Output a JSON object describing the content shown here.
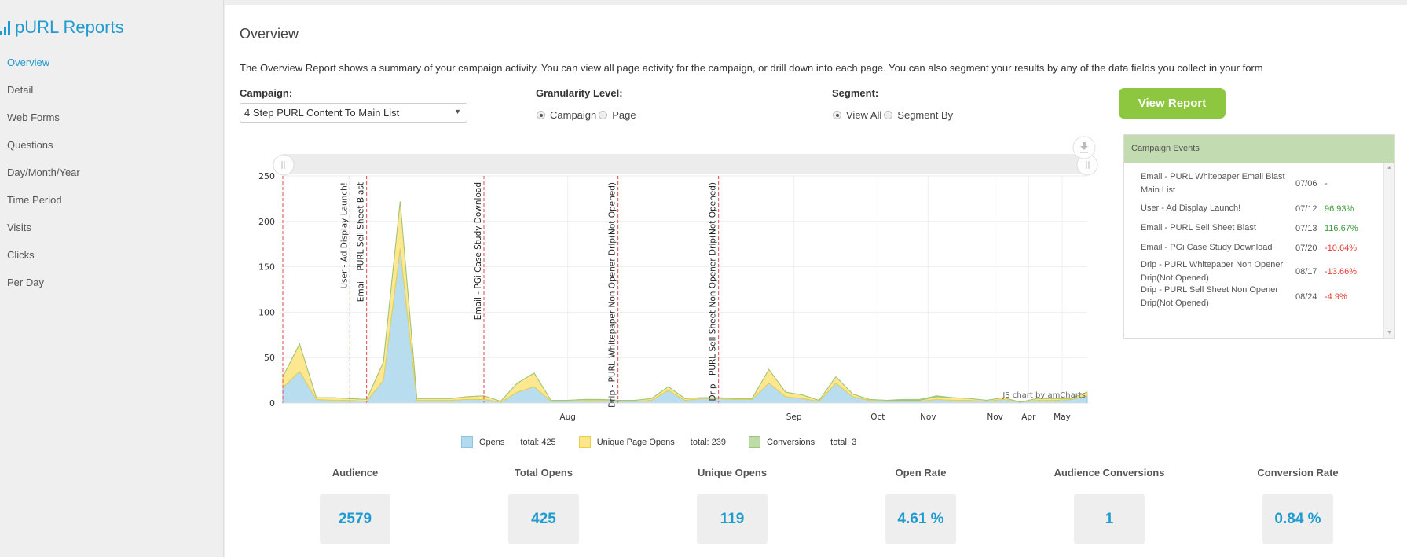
{
  "app": {
    "title": "pURL Reports",
    "brand_icon": "bar-chart-icon"
  },
  "sidebar": {
    "items": [
      {
        "label": "Overview",
        "active": true
      },
      {
        "label": "Detail"
      },
      {
        "label": "Web Forms"
      },
      {
        "label": "Questions"
      },
      {
        "label": "Day/Month/Year"
      },
      {
        "label": "Time Period"
      },
      {
        "label": "Visits"
      },
      {
        "label": "Clicks"
      },
      {
        "label": "Per Day"
      }
    ]
  },
  "main": {
    "title": "Overview",
    "description": "The Overview Report shows a summary of your campaign activity. You can view all page activity for the campaign, or drill down into each page. You can also segment your results by any of the data fields you collect in your form",
    "campaign": {
      "label": "Campaign:",
      "value": "4 Step PURL Content To Main List"
    },
    "granularity": {
      "label": "Granularity Level:",
      "options": [
        "Campaign",
        "Page"
      ],
      "selected": "Campaign"
    },
    "segment": {
      "label": "Segment:",
      "options": [
        "View All",
        "Segment By"
      ],
      "selected": "View All"
    },
    "view_report_label": "View Report"
  },
  "events": {
    "title": "Campaign Events",
    "rows": [
      {
        "name": "Email - PURL Whitepaper Email Blast Main List",
        "date": "07/06",
        "change": "-",
        "trend": "none"
      },
      {
        "name": "User - Ad Display Launch!",
        "date": "07/12",
        "change": "96.93%",
        "trend": "pos"
      },
      {
        "name": "Email - PURL Sell Sheet Blast",
        "date": "07/13",
        "change": "116.67%",
        "trend": "pos"
      },
      {
        "name": "Email - PGi Case Study Download",
        "date": "07/20",
        "change": "-10.64%",
        "trend": "neg"
      },
      {
        "name": "Drip - PURL Whitepaper Non Opener Drip(Not Opened)",
        "date": "08/17",
        "change": "-13.66%",
        "trend": "neg"
      },
      {
        "name": "Drip - PURL Sell Sheet Non Opener Drip(Not Opened)",
        "date": "08/24",
        "change": "-4.9%",
        "trend": "neg"
      }
    ]
  },
  "chart_data": {
    "type": "area",
    "stacked": true,
    "ylim": [
      0,
      250
    ],
    "yticks": [
      0,
      50,
      100,
      150,
      200,
      250
    ],
    "xtick_labels": [
      {
        "label": "Aug",
        "index": 17
      },
      {
        "label": "Sep",
        "index": 30.5
      },
      {
        "label": "Oct",
        "index": 35.5
      },
      {
        "label": "Nov",
        "index": 38.5
      },
      {
        "label": "Nov",
        "index": 42.5
      },
      {
        "label": "Apr",
        "index": 44.5
      },
      {
        "label": "May",
        "index": 46.5
      }
    ],
    "point_count": 48,
    "series": [
      {
        "name": "Opens",
        "total_label": "total: 425",
        "color": "#b3dbee",
        "border": "#8ec5e0",
        "values": [
          17,
          35,
          4,
          3,
          3,
          2,
          25,
          170,
          3,
          3,
          3,
          4,
          4,
          1,
          12,
          18,
          2,
          2,
          3,
          3,
          2,
          2,
          3,
          14,
          3,
          5,
          5,
          4,
          4,
          22,
          7,
          5,
          2,
          22,
          7,
          3,
          2,
          2,
          2,
          4,
          3,
          3,
          2,
          4,
          1,
          3,
          3,
          4,
          8
        ]
      },
      {
        "name": "Unique Page Opens",
        "total_label": "total: 239",
        "color": "#fde68a",
        "border": "#e8cf4c",
        "values": [
          12,
          30,
          2,
          3,
          2,
          2,
          20,
          52,
          2,
          2,
          2,
          3,
          4,
          1,
          10,
          15,
          1,
          1,
          1,
          1,
          1,
          1,
          2,
          4,
          2,
          1,
          1,
          1,
          1,
          15,
          5,
          4,
          1,
          7,
          3,
          1,
          1,
          1,
          1,
          3,
          3,
          2,
          1,
          2,
          0,
          2,
          2,
          1,
          4
        ]
      },
      {
        "name": "Conversions",
        "total_label": "total: 3",
        "color": "#bedaa6",
        "border": "#9cc67c",
        "values": [
          0,
          0,
          0,
          0,
          0,
          0,
          0,
          0,
          0,
          0,
          0,
          0,
          0,
          0,
          0,
          0,
          0,
          0,
          0,
          0,
          0,
          0,
          0,
          0,
          0,
          0,
          0,
          0,
          0,
          0,
          0,
          0,
          0,
          0,
          0,
          0,
          0,
          1,
          1,
          1,
          0,
          0,
          0,
          0,
          0,
          0,
          0,
          0,
          0
        ]
      }
    ],
    "events": [
      {
        "label": "Email - PURL Whitepaper Email Blast Main List",
        "index": 0,
        "show_label": false
      },
      {
        "label": "User - Ad Display Launch!",
        "index": 4
      },
      {
        "label": "Email - PURL Sell Sheet Blast",
        "index": 5
      },
      {
        "label": "Email - PGi Case Study Download",
        "index": 12
      },
      {
        "label": "Drip - PURL Whitepaper Non Opener Drip(Not Opened)",
        "index": 20
      },
      {
        "label": "Drip - PURL Sell Sheet Non Opener Drip(Not Opened)",
        "index": 26
      }
    ],
    "credit": "JS chart by amCharts"
  },
  "metrics": [
    {
      "label": "Audience",
      "value": "2579"
    },
    {
      "label": "Total Opens",
      "value": "425"
    },
    {
      "label": "Unique Opens",
      "value": "119"
    },
    {
      "label": "Open Rate",
      "value": "4.61 %"
    },
    {
      "label": "Audience Conversions",
      "value": "1"
    },
    {
      "label": "Conversion Rate",
      "value": "0.84 %"
    }
  ]
}
